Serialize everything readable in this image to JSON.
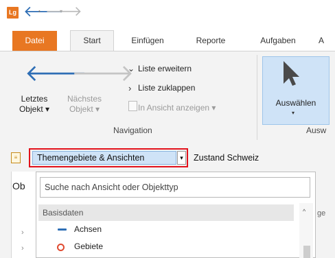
{
  "titlebar": {
    "logo": "Lg",
    "back_icon": "arrow-left-icon",
    "forward_icon": "arrow-right-icon"
  },
  "tabs": [
    {
      "label": "Datei"
    },
    {
      "label": "Start"
    },
    {
      "label": "Einfügen"
    },
    {
      "label": "Reporte"
    },
    {
      "label": "Aufgaben"
    },
    {
      "label": "A"
    }
  ],
  "ribbon": {
    "letztes_label": "Letztes\nObjekt ▾",
    "naechstes_label": "Nächstes\nObjekt ▾",
    "liste_erweitern": "Liste erweitern",
    "liste_zuklappen": "Liste zuklappen",
    "in_ansicht": "In Ansicht anzeigen ▾",
    "group_navigation": "Navigation",
    "auswaehlen": "Auswählen",
    "group_ausw": "Ausw"
  },
  "toolbar": {
    "combo_value": "Themengebiete & Ansichten",
    "zustand": "Zustand Schweiz"
  },
  "panel": {
    "ob_label": "Ob",
    "right_fragment": "ge"
  },
  "dropdown": {
    "search_placeholder": "Suche nach Ansicht oder Objekttyp",
    "group_header": "Basisdaten",
    "items": [
      {
        "label": "Achsen",
        "icon": "line-icon"
      },
      {
        "label": "Gebiete",
        "icon": "circle-icon"
      }
    ]
  },
  "colors": {
    "accent_orange": "#e87722",
    "accent_blue": "#2e6eb5",
    "highlight_red": "#e2111b",
    "selection_blue": "#cfe3f7"
  }
}
